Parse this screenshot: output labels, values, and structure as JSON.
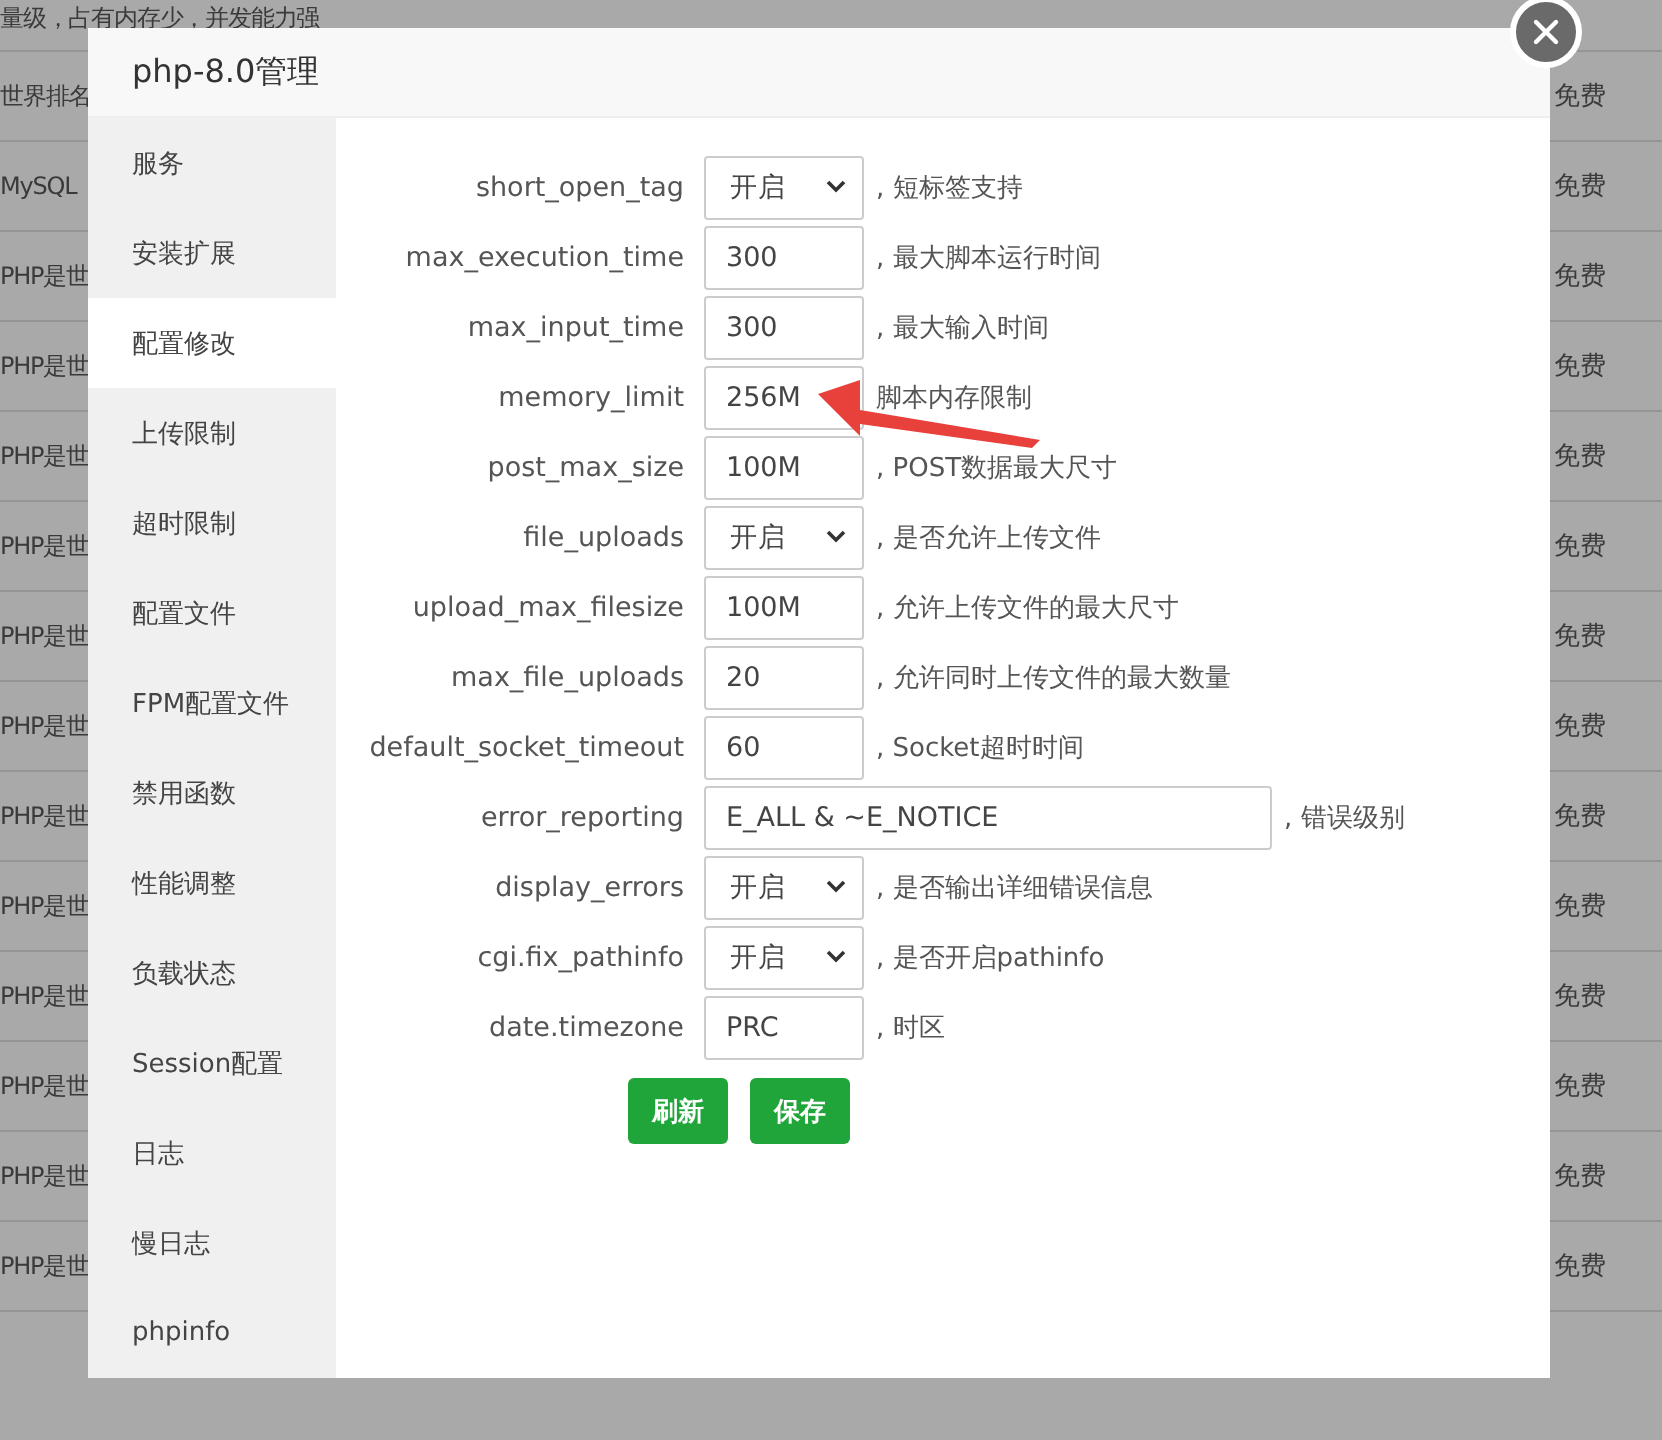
{
  "background": {
    "rows": [
      {
        "text": "量级，占有内存少，并发能力强",
        "price": ""
      },
      {
        "text": "世界排名",
        "price": "免费"
      },
      {
        "text": "MySQL",
        "price": "免费"
      },
      {
        "text": "PHP是世",
        "price": "免费"
      },
      {
        "text": "PHP是世",
        "price": "免费"
      },
      {
        "text": "PHP是世",
        "price": "免费"
      },
      {
        "text": "PHP是世",
        "price": "免费"
      },
      {
        "text": "PHP是世",
        "price": "免费"
      },
      {
        "text": "PHP是世",
        "price": "免费"
      },
      {
        "text": "PHP是世",
        "price": "免费"
      },
      {
        "text": "PHP是世",
        "price": "免费"
      },
      {
        "text": "PHP是世",
        "price": "免费"
      },
      {
        "text": "PHP是世",
        "price": "免费"
      },
      {
        "text": "PHP是世",
        "price": "免费"
      },
      {
        "text": "PHP是世",
        "price": "免费"
      }
    ]
  },
  "dialog": {
    "title": "php-8.0管理",
    "sidebar": {
      "items": [
        {
          "label": "服务",
          "selected": false
        },
        {
          "label": "安装扩展",
          "selected": false
        },
        {
          "label": "配置修改",
          "selected": true
        },
        {
          "label": "上传限制",
          "selected": false
        },
        {
          "label": "超时限制",
          "selected": false
        },
        {
          "label": "配置文件",
          "selected": false
        },
        {
          "label": "FPM配置文件",
          "selected": false
        },
        {
          "label": "禁用函数",
          "selected": false
        },
        {
          "label": "性能调整",
          "selected": false
        },
        {
          "label": "负载状态",
          "selected": false
        },
        {
          "label": "Session配置",
          "selected": false
        },
        {
          "label": "日志",
          "selected": false
        },
        {
          "label": "慢日志",
          "selected": false
        },
        {
          "label": "phpinfo",
          "selected": false
        }
      ]
    },
    "settings": [
      {
        "name": "short_open_tag",
        "kind": "select",
        "value": "开启",
        "description": ", 短标签支持"
      },
      {
        "name": "max_execution_time",
        "kind": "input",
        "value": "300",
        "description": ", 最大脚本运行时间"
      },
      {
        "name": "max_input_time",
        "kind": "input",
        "value": "300",
        "description": ", 最大输入时间"
      },
      {
        "name": "memory_limit",
        "kind": "input",
        "value": "256M",
        "description": "脚本内存限制"
      },
      {
        "name": "post_max_size",
        "kind": "input",
        "value": "100M",
        "description": ", POST数据最大尺寸"
      },
      {
        "name": "file_uploads",
        "kind": "select",
        "value": "开启",
        "description": ", 是否允许上传文件"
      },
      {
        "name": "upload_max_filesize",
        "kind": "input",
        "value": "100M",
        "description": ", 允许上传文件的最大尺寸"
      },
      {
        "name": "max_file_uploads",
        "kind": "input",
        "value": "20",
        "description": ", 允许同时上传文件的最大数量"
      },
      {
        "name": "default_socket_timeout",
        "kind": "input",
        "value": "60",
        "description": ", Socket超时时间"
      },
      {
        "name": "error_reporting",
        "kind": "wide",
        "value": "E_ALL & ~E_NOTICE",
        "description": ", 错误级别"
      },
      {
        "name": "display_errors",
        "kind": "select",
        "value": "开启",
        "description": ", 是否输出详细错误信息"
      },
      {
        "name": "cgi.fix_pathinfo",
        "kind": "select",
        "value": "开启",
        "description": ", 是否开启pathinfo"
      },
      {
        "name": "date.timezone",
        "kind": "input",
        "value": "PRC",
        "description": ", 时区"
      }
    ],
    "buttons": [
      "刷新",
      "保存"
    ]
  }
}
